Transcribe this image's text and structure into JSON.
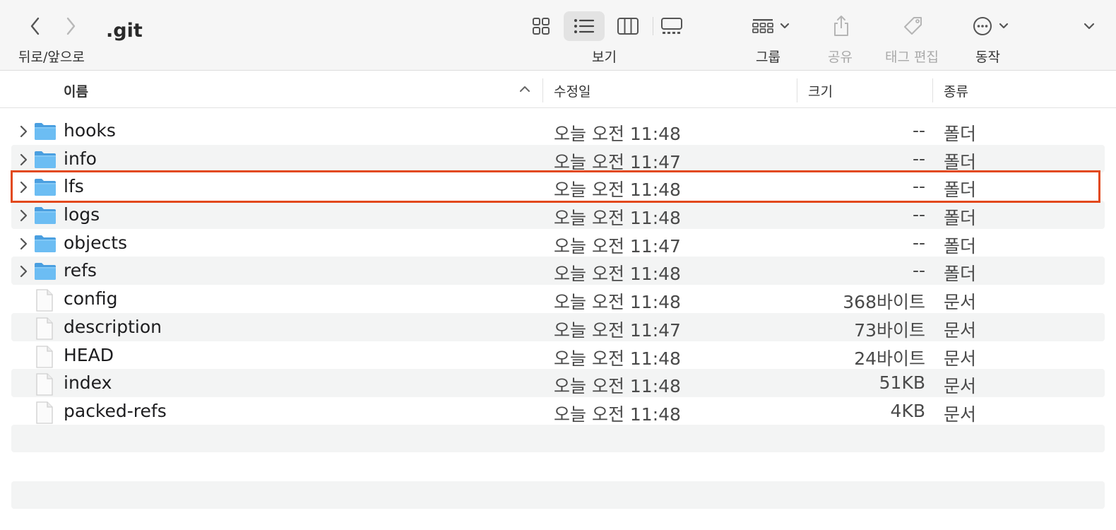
{
  "toolbar": {
    "title": ".git",
    "nav_label": "뒤로/앞으로",
    "view_label": "보기",
    "group_label": "그룹",
    "share_label": "공유",
    "tags_label": "태그 편집",
    "action_label": "동작",
    "back_icon": "chevron-left-icon",
    "forward_icon": "chevron-right-icon",
    "view_options": [
      "icon-view",
      "list-view",
      "column-view",
      "gallery-view"
    ],
    "selected_view": "list-view"
  },
  "columns": {
    "name": "이름",
    "modified": "수정일",
    "size": "크기",
    "kind": "종류",
    "sorted_by": "name",
    "sort_direction": "ascending"
  },
  "files": [
    {
      "name": "hooks",
      "date": "오늘 오전 11:48",
      "size": "--",
      "kind": "폴더",
      "type": "folder"
    },
    {
      "name": "info",
      "date": "오늘 오전 11:47",
      "size": "--",
      "kind": "폴더",
      "type": "folder"
    },
    {
      "name": "lfs",
      "date": "오늘 오전 11:48",
      "size": "--",
      "kind": "폴더",
      "type": "folder"
    },
    {
      "name": "logs",
      "date": "오늘 오전 11:48",
      "size": "--",
      "kind": "폴더",
      "type": "folder"
    },
    {
      "name": "objects",
      "date": "오늘 오전 11:47",
      "size": "--",
      "kind": "폴더",
      "type": "folder"
    },
    {
      "name": "refs",
      "date": "오늘 오전 11:48",
      "size": "--",
      "kind": "폴더",
      "type": "folder"
    },
    {
      "name": "config",
      "date": "오늘 오전 11:48",
      "size": "368바이트",
      "kind": "문서",
      "type": "document"
    },
    {
      "name": "description",
      "date": "오늘 오전 11:47",
      "size": "73바이트",
      "kind": "문서",
      "type": "document"
    },
    {
      "name": "HEAD",
      "date": "오늘 오전 11:48",
      "size": "24바이트",
      "kind": "문서",
      "type": "document"
    },
    {
      "name": "index",
      "date": "오늘 오전 11:48",
      "size": "51KB",
      "kind": "문서",
      "type": "document"
    },
    {
      "name": "packed-refs",
      "date": "오늘 오전 11:48",
      "size": "4KB",
      "kind": "문서",
      "type": "document"
    }
  ],
  "highlighted_row": "lfs",
  "colors": {
    "folder_blue": "#5fb4ef",
    "highlight_border": "#e2491d",
    "stripe": "#f3f4f4"
  }
}
